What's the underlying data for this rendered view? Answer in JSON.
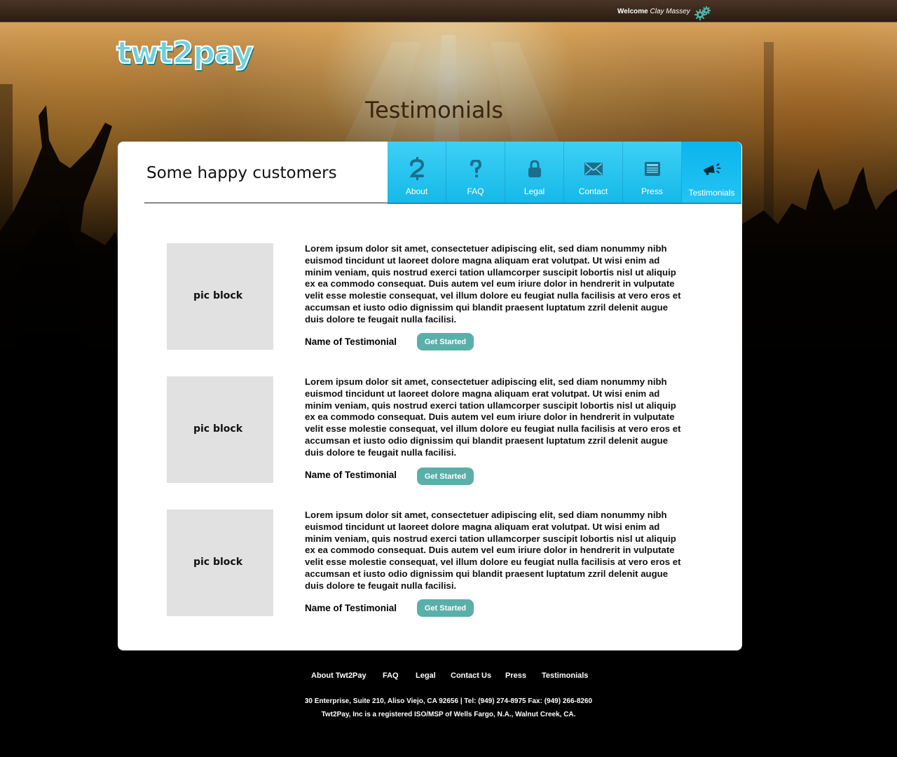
{
  "topbar": {
    "welcome_prefix": "Welcome",
    "user_name": "Clay Massey",
    "settings_icon": "gear-icon"
  },
  "brand": {
    "logo_text": "twt2pay",
    "accent_color": "#15b9e9",
    "button_color": "#5aafa9"
  },
  "page_title": "Testimonials",
  "card": {
    "heading": "Some happy customers"
  },
  "nav": [
    {
      "label": "About",
      "icon": "dollar-sign-icon"
    },
    {
      "label": "FAQ",
      "icon": "question-mark-icon"
    },
    {
      "label": "Legal",
      "icon": "lock-icon"
    },
    {
      "label": "Contact",
      "icon": "envelope-icon"
    },
    {
      "label": "Press",
      "icon": "newspaper-icon"
    },
    {
      "label": "Testimonials",
      "icon": "megaphone-icon",
      "active": true
    }
  ],
  "testimonials": [
    {
      "pic_label": "pic block",
      "body": "Lorem ipsum dolor sit amet, consectetuer adipiscing elit, sed diam nonummy nibh euismod tincidunt ut laoreet dolore magna aliquam erat volutpat. Ut wisi enim ad minim veniam, quis nostrud exerci tation ullamcorper suscipit lobortis nisl ut aliquip ex ea commodo consequat. Duis autem vel eum iriure dolor in hendrerit in vulputate velit esse molestie consequat, vel illum dolore eu feugiat nulla facilisis at vero eros et accumsan et iusto odio dignissim qui blandit praesent luptatum zzril delenit augue duis dolore te feugait nulla facilisi.",
      "name": "Name of Testimonial",
      "button": "Get Started"
    },
    {
      "pic_label": "pic block",
      "body": "Lorem ipsum dolor sit amet, consectetuer adipiscing elit, sed diam nonummy nibh euismod tincidunt ut laoreet dolore magna aliquam erat volutpat. Ut wisi enim ad minim veniam, quis nostrud exerci tation ullamcorper suscipit lobortis nisl ut aliquip ex ea commodo consequat. Duis autem vel eum iriure dolor in hendrerit in vulputate velit esse molestie consequat, vel illum dolore eu feugiat nulla facilisis at vero eros et accumsan et iusto odio dignissim qui blandit praesent luptatum zzril delenit augue duis dolore te feugait nulla facilisi.",
      "name": "Name of Testimonial",
      "button": "Get Started"
    },
    {
      "pic_label": "pic block",
      "body": "Lorem ipsum dolor sit amet, consectetuer adipiscing elit, sed diam nonummy nibh euismod tincidunt ut laoreet dolore magna aliquam erat volutpat. Ut wisi enim ad minim veniam, quis nostrud exerci tation ullamcorper suscipit lobortis nisl ut aliquip ex ea commodo consequat. Duis autem vel eum iriure dolor in hendrerit in vulputate velit esse molestie consequat, vel illum dolore eu feugiat nulla facilisis at vero eros et accumsan et iusto odio dignissim qui blandit praesent luptatum zzril delenit augue duis dolore te feugait nulla facilisi.",
      "name": "Name of Testimonial",
      "button": "Get Started"
    }
  ],
  "footer": {
    "links": [
      "About Twt2Pay",
      "FAQ",
      "Legal",
      "Contact Us",
      "Press",
      "Testimonials"
    ],
    "address": "30 Enterprise, Suite 210, Aliso Viejo, CA 92656 | Tel: (949) 274-8975 Fax: (949) 266-8260",
    "legal": "Twt2Pay, Inc is a registered ISO/MSP of Wells Fargo, N.A., Walnut Creek, CA."
  }
}
